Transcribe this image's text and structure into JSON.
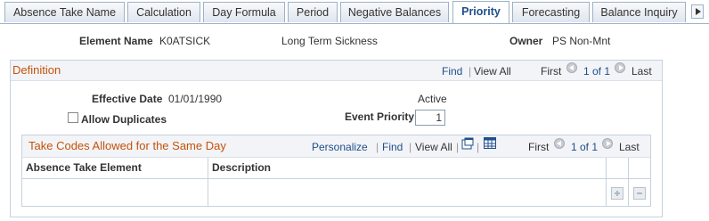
{
  "tabs": [
    {
      "label": "Absence Take Name",
      "active": false
    },
    {
      "label": "Calculation",
      "active": false
    },
    {
      "label": "Day Formula",
      "active": false
    },
    {
      "label": "Period",
      "active": false
    },
    {
      "label": "Negative Balances",
      "active": false
    },
    {
      "label": "Priority",
      "active": true
    },
    {
      "label": "Forecasting",
      "active": false
    },
    {
      "label": "Balance Inquiry",
      "active": false
    }
  ],
  "header": {
    "element_name_label": "Element Name",
    "element_name_value": "K0ATSICK",
    "element_description": "Long Term Sickness",
    "owner_label": "Owner",
    "owner_value": "PS Non-Mnt"
  },
  "definition": {
    "title": "Definition",
    "find": "Find",
    "separator": "|",
    "view_all": "View All",
    "first": "First",
    "range": "1 of 1",
    "last": "Last",
    "effective_date_label": "Effective Date",
    "effective_date_value": "01/01/1990",
    "status": "Active",
    "allow_duplicates_label": "Allow Duplicates",
    "allow_duplicates_checked": false,
    "event_priority_label": "Event Priority",
    "event_priority_value": "1"
  },
  "take_codes": {
    "title": "Take Codes Allowed for the Same Day",
    "personalize": "Personalize",
    "find": "Find",
    "view_all": "View All",
    "separator": "|",
    "first": "First",
    "range": "1 of 1",
    "last": "Last",
    "columns": [
      "Absence Take Element",
      "Description"
    ],
    "rows": [
      {
        "absence_take_element": "",
        "description": ""
      }
    ]
  },
  "colors": {
    "link": "#1f4e8c",
    "section_title": "#c5520a",
    "border": "#c6d2de"
  }
}
